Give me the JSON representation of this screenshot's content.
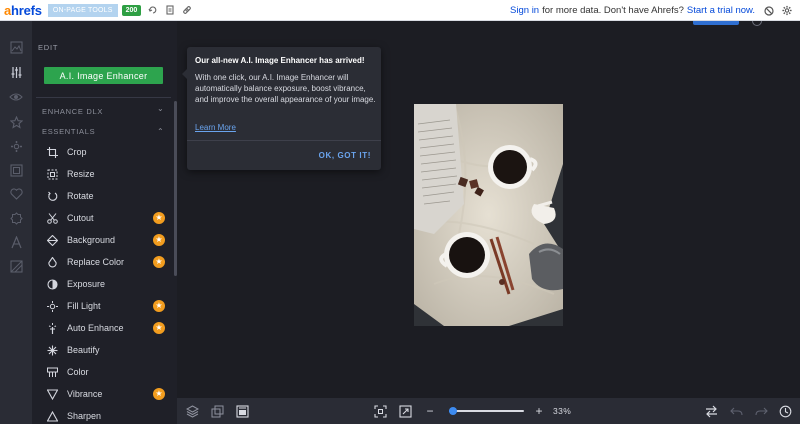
{
  "toolbar": {
    "logo_a": "a",
    "logo_rest": "hrefs",
    "on_page_tools": "ON-PAGE TOOLS",
    "status_code": "200",
    "sign_in": "Sign in",
    "sign_in_suffix": "for more data. Don't have Ahrefs?",
    "start_trial": "Start a trial now."
  },
  "rail": {
    "icons": [
      "image-icon",
      "adjust-sliders-icon",
      "eye-icon",
      "star-icon",
      "gear-icon",
      "frame-icon",
      "heart-icon",
      "badge-icon",
      "text-icon",
      "texture-icon"
    ],
    "active_index": 1
  },
  "panel": {
    "header": "EDIT",
    "enhancer_button": "A.I. Image Enhancer",
    "sections": [
      {
        "label": "ENHANCE DLX",
        "chevron": "⌄"
      },
      {
        "label": "ESSENTIALS",
        "chevron": "⌃"
      }
    ],
    "tools": [
      {
        "label": "Crop",
        "icon": "crop-icon",
        "premium": false
      },
      {
        "label": "Resize",
        "icon": "resize-icon",
        "premium": false
      },
      {
        "label": "Rotate",
        "icon": "rotate-icon",
        "premium": false
      },
      {
        "label": "Cutout",
        "icon": "scissors-icon",
        "premium": true
      },
      {
        "label": "Background",
        "icon": "background-icon",
        "premium": true
      },
      {
        "label": "Replace Color",
        "icon": "drop-icon",
        "premium": true
      },
      {
        "label": "Exposure",
        "icon": "exposure-icon",
        "premium": false
      },
      {
        "label": "Fill Light",
        "icon": "fill-light-icon",
        "premium": true
      },
      {
        "label": "Auto Enhance",
        "icon": "wand-icon",
        "premium": true
      },
      {
        "label": "Beautify",
        "icon": "sparkle-icon",
        "premium": false
      },
      {
        "label": "Color",
        "icon": "color-icon",
        "premium": false
      },
      {
        "label": "Vibrance",
        "icon": "vibrance-icon",
        "premium": true
      },
      {
        "label": "Sharpen",
        "icon": "triangle-icon",
        "premium": false
      }
    ]
  },
  "popup": {
    "title": "Our all-new A.I. Image Enhancer has arrived!",
    "body": "With one click, our A.I. Image Enhancer will automatically balance exposure, boost vibrance, and improve the overall appearance of your image.",
    "link": "Learn More",
    "ok": "OK, GOT IT!"
  },
  "bottombar": {
    "zoom_minus": "−",
    "zoom_plus": "+",
    "zoom_label": "33%",
    "zoom_value": 0.05
  },
  "colors": {
    "accent_green": "#2da44e",
    "accent_blue": "#3d8bf0",
    "premium_orange": "#f29d1f",
    "panel_bg": "#1f2028"
  }
}
